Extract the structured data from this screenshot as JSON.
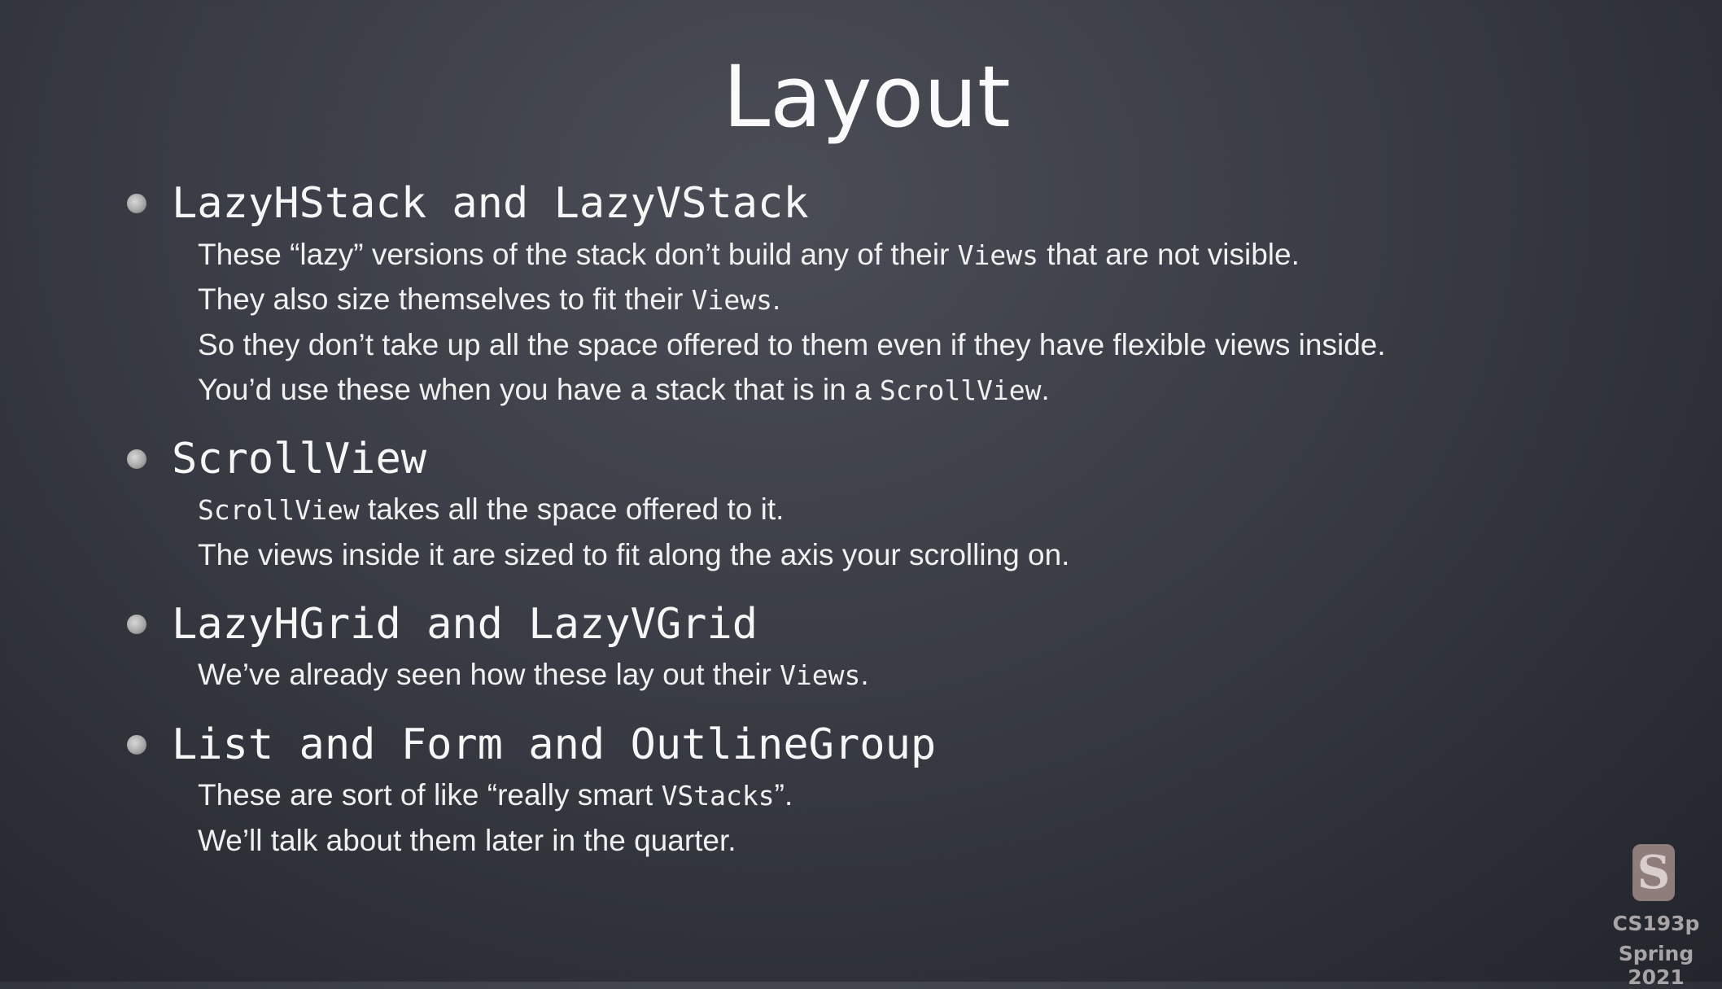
{
  "slide": {
    "title": "Layout",
    "sections": [
      {
        "heading": "LazyHStack and LazyVStack",
        "lines": [
          [
            {
              "t": "These “lazy” versions of the stack don’t build any of their "
            },
            {
              "t": "Views",
              "code": true
            },
            {
              "t": " that are not visible."
            }
          ],
          [
            {
              "t": "They also size themselves to fit their "
            },
            {
              "t": "Views",
              "code": true
            },
            {
              "t": "."
            }
          ],
          [
            {
              "t": "So they don’t take up all the space offered to them even if they have flexible views inside."
            }
          ],
          [
            {
              "t": "You’d use these when you have a stack that is in a "
            },
            {
              "t": "ScrollView",
              "code": true
            },
            {
              "t": "."
            }
          ]
        ]
      },
      {
        "heading": "ScrollView",
        "lines": [
          [
            {
              "t": "ScrollView",
              "code": true
            },
            {
              "t": " takes all the space offered to it."
            }
          ],
          [
            {
              "t": "The views inside it are sized to fit along the axis your scrolling on."
            }
          ]
        ]
      },
      {
        "heading": "LazyHGrid and LazyVGrid",
        "lines": [
          [
            {
              "t": "We’ve already seen how these lay out their "
            },
            {
              "t": "Views",
              "code": true
            },
            {
              "t": "."
            }
          ]
        ]
      },
      {
        "heading": "List and Form and OutlineGroup",
        "lines": [
          [
            {
              "t": "These are sort of like “really smart "
            },
            {
              "t": "VStacks",
              "code": true
            },
            {
              "t": "”."
            }
          ],
          [
            {
              "t": "We’ll talk about them later in the quarter."
            }
          ]
        ]
      }
    ]
  },
  "footer": {
    "logo": "S",
    "course": "CS193p",
    "term": "Spring 2021"
  }
}
